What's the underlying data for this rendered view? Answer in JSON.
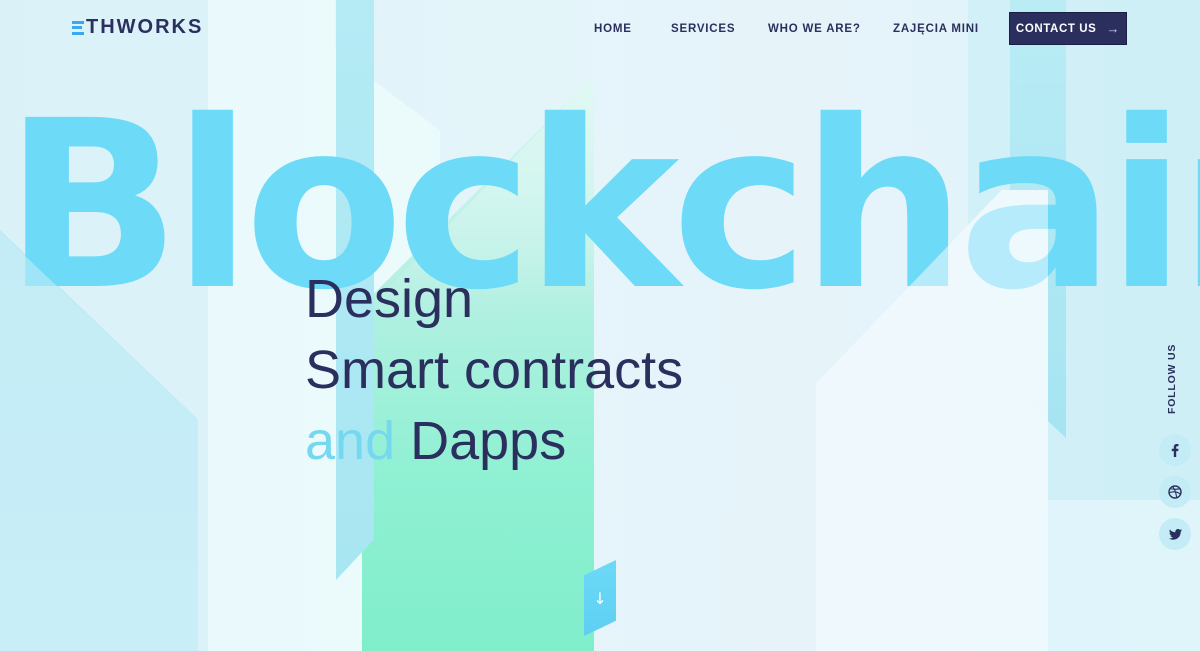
{
  "header": {
    "logo_text": "THWORKS",
    "logo_mark": "E",
    "nav": {
      "home": "HOME",
      "services": "SERVICES",
      "who": "WHO WE ARE?",
      "zajecia": "ZAJĘCIA MINI"
    },
    "contact_label": "CONTACT US",
    "contact_icon": "arrow-right-icon"
  },
  "hero": {
    "background_word": "Blockchain",
    "line1": "Design",
    "line2": "Smart contracts",
    "line3_and": "and",
    "line3_rest": "Dapps",
    "scroll_icon": "arrow-down-icon"
  },
  "follow": {
    "label": "FOLLOW US",
    "icons": [
      "facebook-icon",
      "dribbble-icon",
      "twitter-icon"
    ]
  },
  "colors": {
    "primary": "#2b2f5e",
    "accent_blue": "#6ddaf8",
    "accent_light": "#75d8ee",
    "green": "#8ff0d2"
  }
}
